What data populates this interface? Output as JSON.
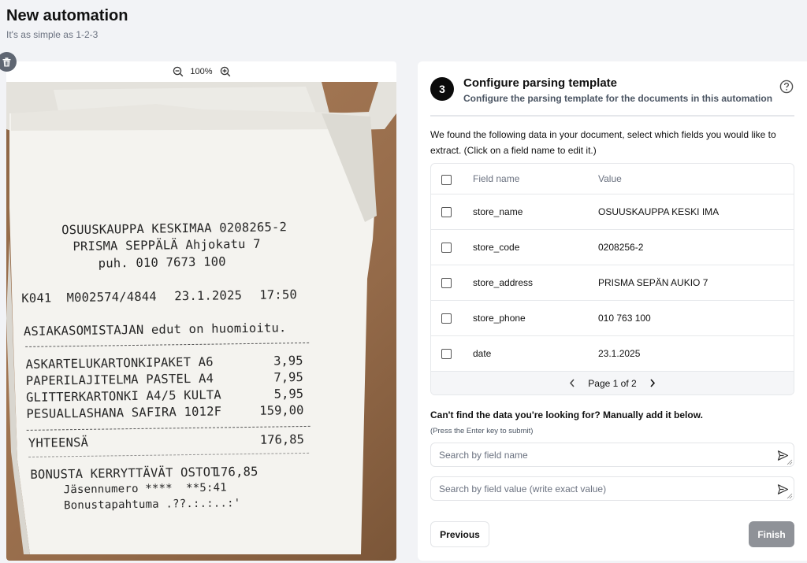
{
  "page": {
    "title": "New automation",
    "subtitle": "It's as simple as 1-2-3"
  },
  "viewer": {
    "zoom_level": "100%",
    "zoom_out_icon": "zoom-out-icon",
    "zoom_in_icon": "zoom-in-icon",
    "delete_icon": "trash-icon",
    "receipt": {
      "header_line1": "OSUUSKAUPPA KESKIMAA 0208265-2",
      "header_line2": "PRISMA SEPPÄLÄ Ahjokatu 7",
      "header_line3": "puh. 010 7673 100",
      "trans_id": "K041  M002574/4844",
      "trans_date": "23.1.2025",
      "trans_time": "17:50",
      "member_note": "ASIAKASOMISTAJAN edut on huomioitu.",
      "items": [
        {
          "name": "ASKARTELUKARTONKIPAKET A6",
          "price": "3,95"
        },
        {
          "name": "PAPERILAJITELMA PASTEL A4",
          "price": "7,95"
        },
        {
          "name": "GLITTERKARTONKI A4/5 KULTA",
          "price": "5,95"
        },
        {
          "name": "PESUALLASHANA SAFIRA 1012F",
          "price": "159,00"
        }
      ],
      "total_label": "YHTEENSÄ",
      "total_value": "176,85",
      "bonus_label": "BONUSTA KERRYTTÄVÄT OSTOT",
      "bonus_value": "176,85",
      "member_number": "Jäsennumero ****  **5:41",
      "bonus_event": "Bonustapahtuma .??.:.:..:'"
    }
  },
  "panel": {
    "step_number": "3",
    "title": "Configure parsing template",
    "subtitle": "Configure the parsing template for the documents in this automation",
    "help_icon": "help-circle-icon",
    "instructions": "We found the following data in your document, select which fields you would like to extract. (Click on a field name to edit it.)",
    "table": {
      "headers": {
        "name": "Field name",
        "value": "Value"
      },
      "rows": [
        {
          "name": "store_name",
          "value": "OSUUSKAUPPA KESKI IMA"
        },
        {
          "name": "store_code",
          "value": "0208256-2"
        },
        {
          "name": "store_address",
          "value": "PRISMA SEPÄN AUKIO 7"
        },
        {
          "name": "store_phone",
          "value": "010 763 100"
        },
        {
          "name": "date",
          "value": "23.1.2025"
        }
      ],
      "pagination": "Page 1 of 2"
    },
    "manual_add": {
      "title": "Can't find the data you're looking for? Manually add it below.",
      "hint": "(Press the Enter key to submit)",
      "field_name_placeholder": "Search by field name",
      "field_value_placeholder": "Search by field value (write exact value)",
      "send_icon": "send-icon"
    },
    "buttons": {
      "previous": "Previous",
      "finish": "Finish"
    }
  }
}
